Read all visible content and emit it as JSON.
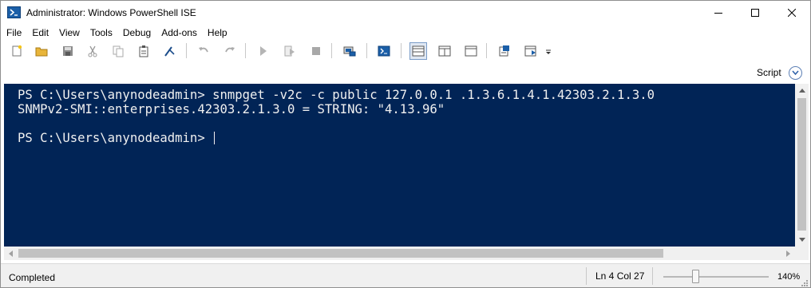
{
  "window": {
    "title": "Administrator: Windows PowerShell ISE",
    "app_icon": "powershell-ise-icon",
    "controls": [
      "minimize-icon",
      "maximize-icon",
      "close-icon"
    ]
  },
  "menu": [
    "File",
    "Edit",
    "View",
    "Tools",
    "Debug",
    "Add-ons",
    "Help"
  ],
  "toolbar": {
    "buttons": [
      "new-icon",
      "open-icon",
      "save-icon",
      "cut-icon",
      "copy-icon",
      "paste-icon",
      "clear-console-icon",
      "undo-icon",
      "redo-icon",
      "run-icon",
      "run-selection-icon",
      "stop-icon",
      "remote-powershell-icon",
      "start-powershell-icon",
      "show-script-top-icon",
      "show-script-right-icon",
      "show-script-maximized-icon",
      "show-command-window-icon",
      "show-command-addon-icon",
      "more-icon"
    ]
  },
  "script_bar": {
    "label": "Script",
    "toggle_icon": "chevron-down-circle-icon"
  },
  "console": {
    "background": "#012456",
    "foreground": "#f0f0f0",
    "lines": [
      "PS C:\\Users\\anynodeadmin> snmpget -v2c -c public 127.0.0.1 .1.3.6.1.4.1.42303.2.1.3.0",
      "SNMPv2-SMI::enterprises.42303.2.1.3.0 = STRING: \"4.13.96\"",
      "PS C:\\Users\\anynodeadmin> "
    ]
  },
  "status": {
    "text": "Completed",
    "position": "Ln 4  Col 27",
    "zoom_label": "140%",
    "zoom_level_percent": 140
  }
}
